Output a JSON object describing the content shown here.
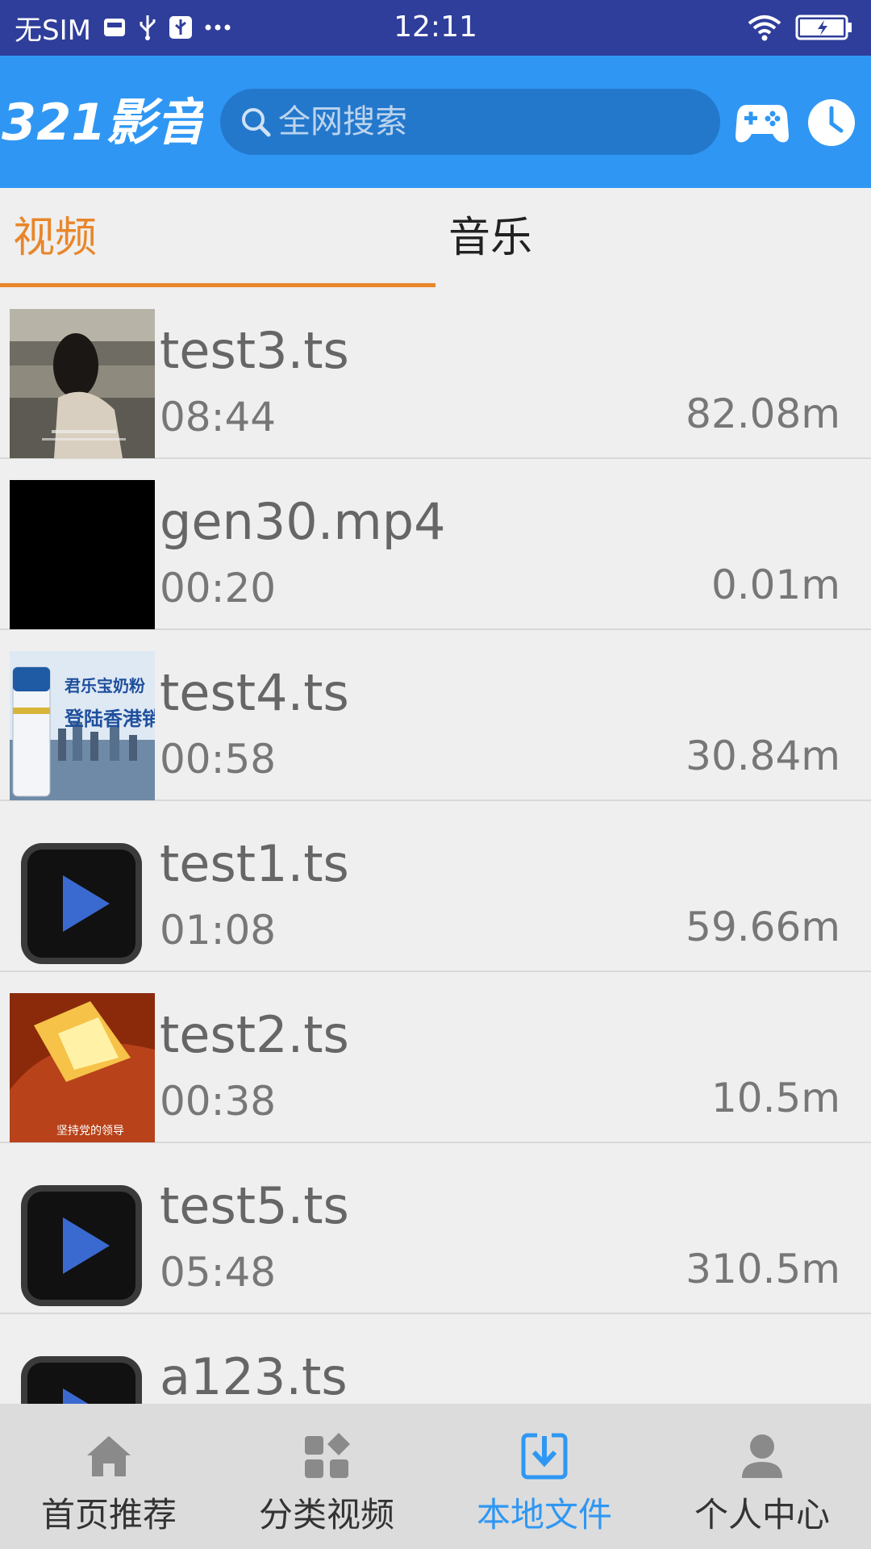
{
  "status_bar": {
    "carrier": "无SIM",
    "icons": [
      "vivo-icon",
      "usb-icon",
      "usb-debug-icon",
      "more-icon"
    ],
    "time": "12:11",
    "right_icons": [
      "wifi-icon",
      "battery-charging-icon"
    ]
  },
  "header": {
    "logo_text": "321影音",
    "search_placeholder": "全网搜索",
    "actions": [
      "gamepad-icon",
      "clock-icon"
    ],
    "brand_color": "#2f97f3"
  },
  "tabs": {
    "items": [
      {
        "label": "视频",
        "active": true
      },
      {
        "label": "音乐",
        "active": false
      }
    ],
    "active_color": "#e8862a"
  },
  "videos": [
    {
      "name": "test3.ts",
      "duration": "08:44",
      "size": "82.08m",
      "thumb": "photo-woman"
    },
    {
      "name": "gen30.mp4",
      "duration": "00:20",
      "size": "0.01m",
      "thumb": "black"
    },
    {
      "name": "test4.ts",
      "duration": "00:58",
      "size": "30.84m",
      "thumb": "milk-ad"
    },
    {
      "name": "test1.ts",
      "duration": "01:08",
      "size": "59.66m",
      "thumb": "play-icon"
    },
    {
      "name": "test2.ts",
      "duration": "00:38",
      "size": "10.5m",
      "thumb": "fire"
    },
    {
      "name": "test5.ts",
      "duration": "05:48",
      "size": "310.5m",
      "thumb": "play-icon"
    },
    {
      "name": "a123.ts",
      "duration": "",
      "size": "",
      "thumb": "play-icon"
    }
  ],
  "thumb_text": {
    "milk_ad_line1": "君乐宝奶粉",
    "milk_ad_line2": "登陆香港销",
    "fire_caption": "坚持党的领导"
  },
  "bottom_nav": [
    {
      "label": "首页推荐",
      "icon": "home-icon",
      "active": false
    },
    {
      "label": "分类视频",
      "icon": "category-icon",
      "active": false
    },
    {
      "label": "本地文件",
      "icon": "download-icon",
      "active": true
    },
    {
      "label": "个人中心",
      "icon": "person-icon",
      "active": false
    }
  ]
}
